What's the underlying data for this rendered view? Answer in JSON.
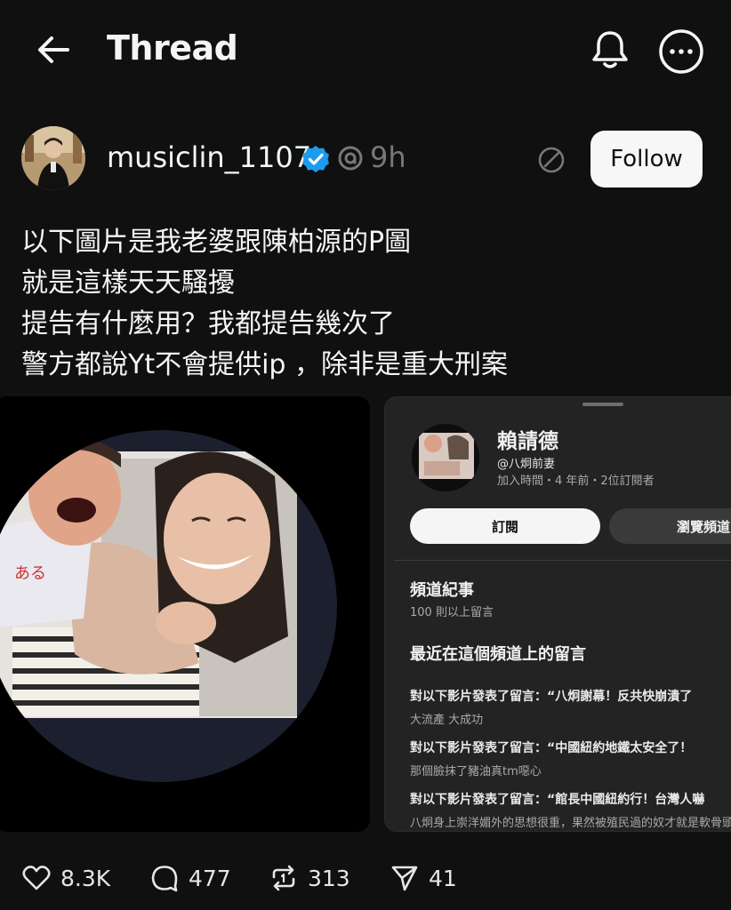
{
  "header": {
    "title": "Thread",
    "back_icon": "arrow-left-icon",
    "bell_icon": "bell-icon",
    "more_icon": "more-horizontal-icon"
  },
  "post": {
    "username": "musiclin_1107",
    "time": "9h",
    "follow_label": "Follow",
    "text_lines": [
      "以下圖片是我老婆跟陳柏源的P圖",
      "就是這樣天天騷擾",
      "提告有什麼用？我都提告幾次了",
      "警方都說Yt不會提供ip ，除非是重大刑案"
    ]
  },
  "channel_screenshot": {
    "name": "賴請德",
    "handle": "@八炯前妻",
    "meta": "加入時間・4 年前・2位訂閱者",
    "subscribe_label": "訂閱",
    "browse_label": "瀏覽頻道",
    "posts_title": "頻道紀事",
    "posts_sub": "100 則以上留言",
    "recent_title": "最近在這個頻道上的留言",
    "comments": [
      {
        "title": "對以下影片發表了留言：“八炯謝幕！反共快崩潰了",
        "body": "大流產 大成功"
      },
      {
        "title": "對以下影片發表了留言：“中國紐約地鐵太安全了！",
        "body": "那個臉抹了豬油真tm噁心"
      },
      {
        "title": "對以下影片發表了留言：“館長中國紐約行！台灣人嚇",
        "body": "八炯身上崇洋媚外的思想很重，果然被殖民過的奴才就是軟骨頭"
      }
    ]
  },
  "actions": {
    "likes": "8.3K",
    "comments": "477",
    "reposts": "313",
    "shares": "41"
  },
  "colors": {
    "background": "#101010",
    "verified": "#1d9bf0",
    "muted_text": "#777777"
  }
}
